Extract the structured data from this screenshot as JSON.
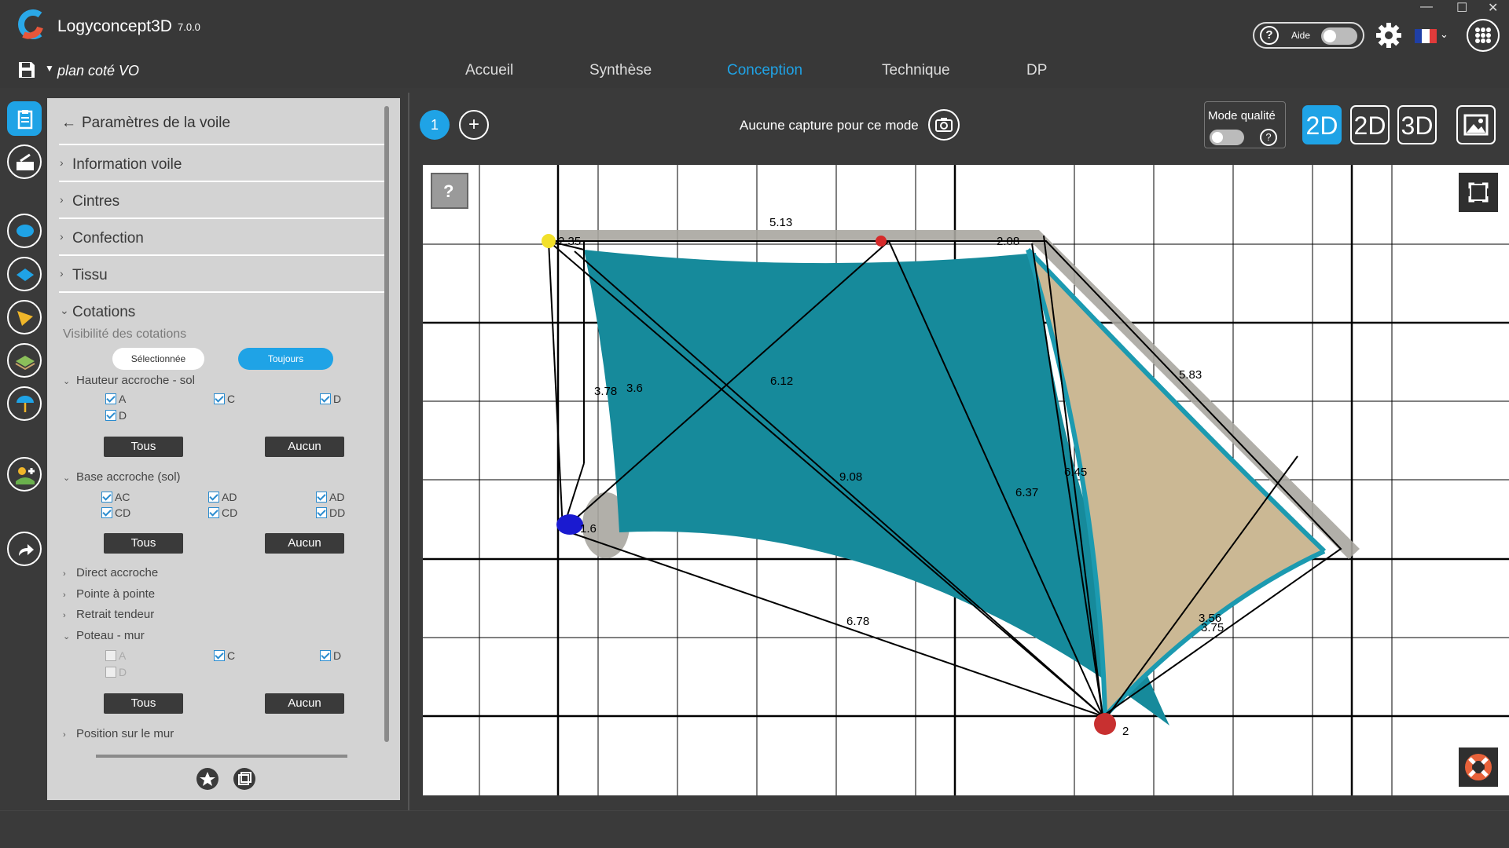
{
  "app": {
    "name": "Logyconcept3D",
    "version": "7.0.0",
    "help_label": "Aide",
    "window_controls": [
      "—",
      "☐",
      "✕"
    ]
  },
  "colors": {
    "accent": "#1fa3e6",
    "sail_teal": "#168a9b",
    "sail_beige": "#cbb894",
    "wall_gray": "#a8a6a0"
  },
  "project": {
    "name": "plan coté VO"
  },
  "nav": {
    "items": [
      "Accueil",
      "Synthèse",
      "Conception",
      "Technique",
      "DP"
    ],
    "active": "Conception"
  },
  "toolbar_icons": [
    "clipboard-icon",
    "toolbox-icon",
    "sail-round-icon",
    "sail-square-icon",
    "sail-triangle-icon",
    "ground-icon",
    "umbrella-icon",
    "sun-add-icon",
    "share-icon"
  ],
  "panel": {
    "back_title": "Paramètres de la voile",
    "sections": [
      "Information voile",
      "Cintres",
      "Confection",
      "Tissu",
      "Cotations"
    ],
    "visibility_label": "Visibilité des cotations",
    "visibility_options": [
      "Sélectionnée",
      "Toujours"
    ],
    "visibility_selected": "Toujours",
    "hauteur": {
      "title": "Hauteur accroche - sol",
      "checks": [
        {
          "label": "A",
          "checked": true
        },
        {
          "label": "C",
          "checked": true
        },
        {
          "label": "D",
          "checked": true
        },
        {
          "label": "D",
          "checked": true
        }
      ],
      "btn_all": "Tous",
      "btn_none": "Aucun"
    },
    "base": {
      "title": "Base accroche (sol)",
      "checks": [
        {
          "label": "AC",
          "checked": true
        },
        {
          "label": "AD",
          "checked": true
        },
        {
          "label": "AD",
          "checked": true
        },
        {
          "label": "CD",
          "checked": true
        },
        {
          "label": "CD",
          "checked": true
        },
        {
          "label": "DD",
          "checked": true
        }
      ],
      "btn_all": "Tous",
      "btn_none": "Aucun"
    },
    "links": [
      "Direct accroche",
      "Pointe à pointe",
      "Retrait tendeur"
    ],
    "poteau": {
      "title": "Poteau - mur",
      "checks": [
        {
          "label": "A",
          "checked": false,
          "disabled": true
        },
        {
          "label": "C",
          "checked": true
        },
        {
          "label": "D",
          "checked": true
        },
        {
          "label": "D",
          "checked": false,
          "disabled": true
        }
      ],
      "btn_all": "Tous",
      "btn_none": "Aucun"
    },
    "position_mur": "Position sur le mur"
  },
  "viewport": {
    "capture_badge": "1",
    "add_capture": "+",
    "capture_text": "Aucune capture pour ce mode",
    "quality_label": "Mode qualité",
    "view_buttons": [
      "2D",
      "2D",
      "3D"
    ],
    "active_view": "2D",
    "help_glyph": "?",
    "dimension_labels": {
      "top": "5.13",
      "diag_right": "5.83",
      "left_outer": "3.78",
      "left_inner": "3.6",
      "diag_top": "6.12",
      "diag_long": "9.08",
      "mid": "6.37",
      "mid2": "6.45",
      "bottom": "6.78",
      "right_low1": "3.56",
      "right_low2": "3.75",
      "height_a": "2.35",
      "height_b": "2.08",
      "height_c": "1.6",
      "height_d": "2"
    }
  }
}
